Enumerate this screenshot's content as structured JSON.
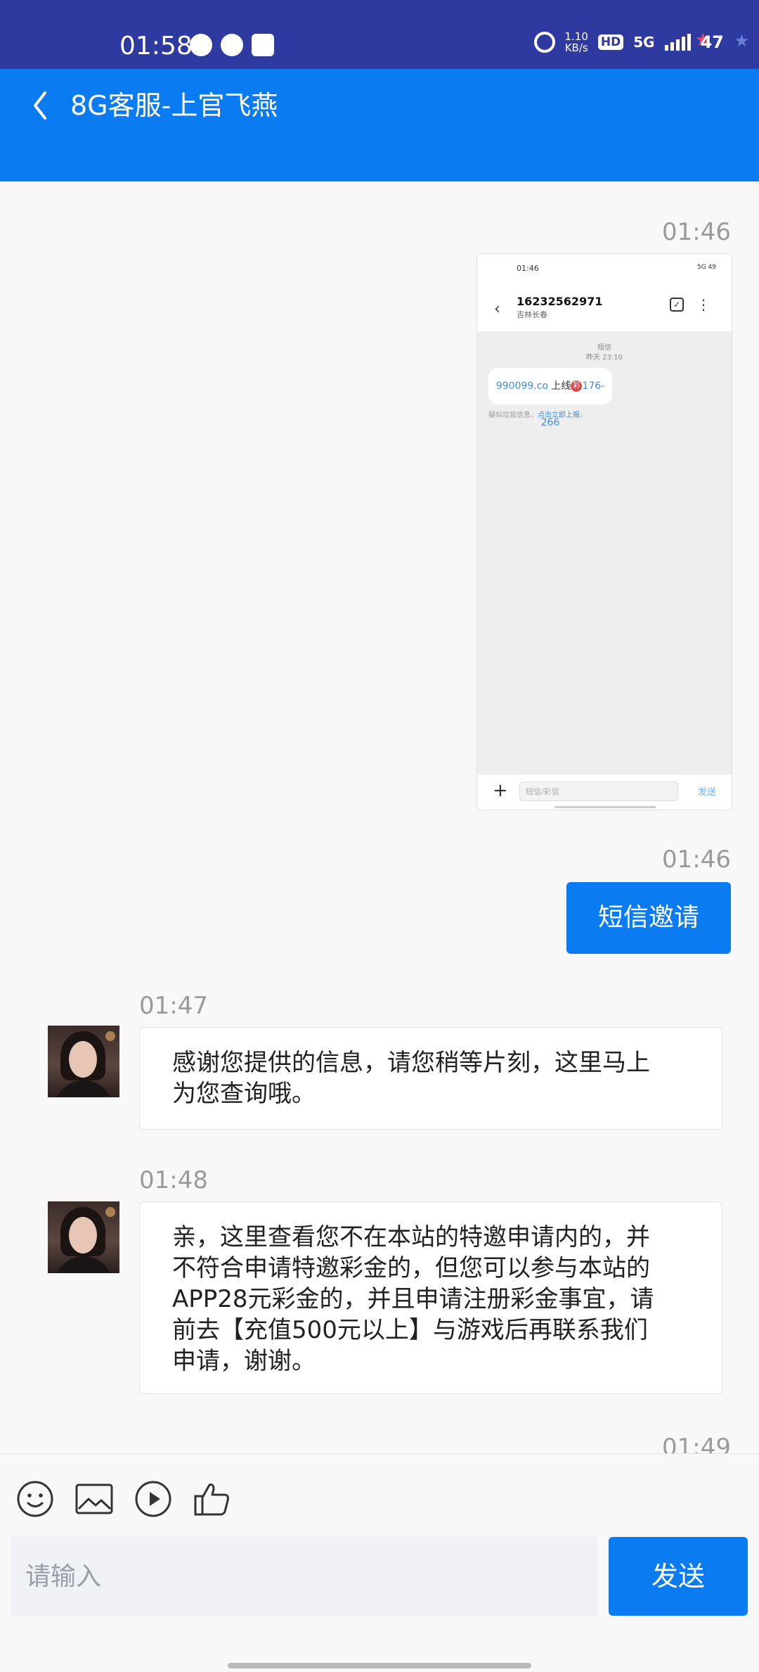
{
  "status_bar": {
    "time": "01:58",
    "speed_value": "1.10",
    "speed_unit": "KB/s",
    "hd": "HD",
    "network": "5G",
    "battery": "47"
  },
  "header": {
    "title": "8G客服-上官飞燕"
  },
  "messages": [
    {
      "type": "image",
      "time": "01:46",
      "screenshot": {
        "status_time": "01:46",
        "status_right": "5G 49",
        "contact_number": "16232562971",
        "contact_location": "吉林长春",
        "message_type": "短信",
        "message_time": "昨天 23:10",
        "sms_link": "990099.co",
        "sms_text_mid": " 上线",
        "sms_badge": "彩",
        "sms_phone": "176-266",
        "report_text": "疑似垃圾信息，",
        "report_link": "点击立即上报",
        "report_end": "。",
        "input_placeholder": "短信/彩信",
        "send_label": "发送"
      }
    },
    {
      "type": "text_sent",
      "time": "01:46",
      "text": "短信邀请"
    },
    {
      "type": "text_received",
      "time": "01:47",
      "text": "感谢您提供的信息，请您稍等片刻，这里马上\n为您查询哦。"
    },
    {
      "type": "text_received",
      "time": "01:48",
      "text": "亲，这里查看您不在本站的特邀申请内的，并\n不符合申请特邀彩金的，但您可以参与本站的\nAPP28元彩金的，并且申请注册彩金事宜，请\n前去【充值500元以上】与游戏后再联系我们\n申请，谢谢。"
    },
    {
      "type": "partial",
      "time": "01:49"
    }
  ],
  "footer": {
    "tools": [
      "emoji-icon",
      "image-icon",
      "video-icon",
      "thumbs-up-icon"
    ],
    "input_placeholder": "请输入",
    "send_label": "发送"
  },
  "colors": {
    "status_bar": "#2f3aa0",
    "primary": "#0a7bf0",
    "background": "#f8f8f8"
  }
}
